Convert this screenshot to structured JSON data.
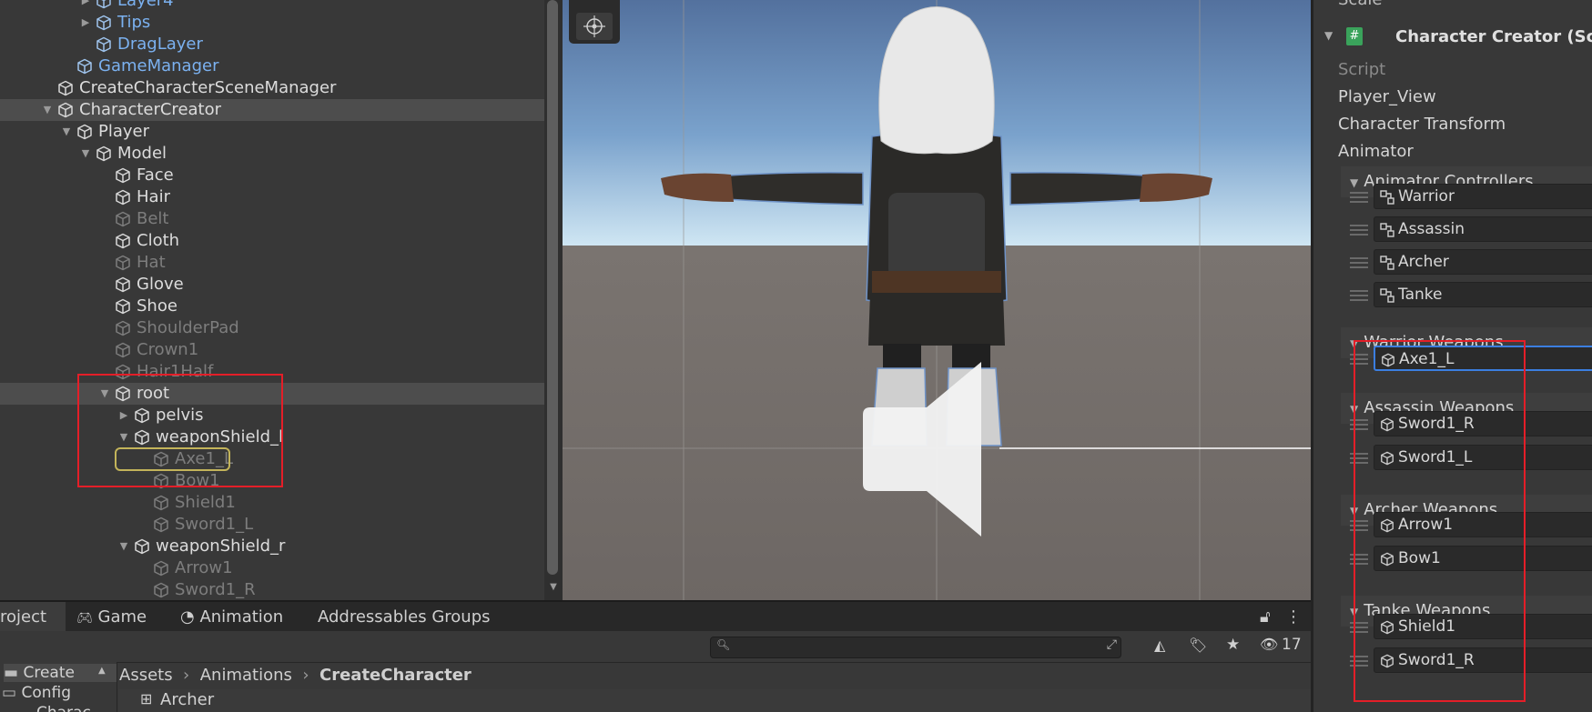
{
  "hierarchy": {
    "rows": [
      {
        "label": "Layer4",
        "depth": 4,
        "arrow": "right",
        "color": "blue"
      },
      {
        "label": "Tips",
        "depth": 4,
        "arrow": "right",
        "color": "blue"
      },
      {
        "label": "DragLayer",
        "depth": 4,
        "arrow": "",
        "color": "blue"
      },
      {
        "label": "GameManager",
        "depth": 3,
        "arrow": "",
        "color": "blue"
      },
      {
        "label": "CreateCharacterSceneManager",
        "depth": 2,
        "arrow": "",
        "color": "white"
      },
      {
        "label": "CharacterCreator",
        "depth": 2,
        "arrow": "down",
        "color": "white",
        "selected": true
      },
      {
        "label": "Player",
        "depth": 3,
        "arrow": "down",
        "color": "white"
      },
      {
        "label": "Model",
        "depth": 4,
        "arrow": "down",
        "color": "white"
      },
      {
        "label": "Face",
        "depth": 5,
        "arrow": "",
        "color": "white"
      },
      {
        "label": "Hair",
        "depth": 5,
        "arrow": "",
        "color": "white"
      },
      {
        "label": "Belt",
        "depth": 5,
        "arrow": "",
        "color": "dim"
      },
      {
        "label": "Cloth",
        "depth": 5,
        "arrow": "",
        "color": "white"
      },
      {
        "label": "Hat",
        "depth": 5,
        "arrow": "",
        "color": "dim"
      },
      {
        "label": "Glove",
        "depth": 5,
        "arrow": "",
        "color": "white"
      },
      {
        "label": "Shoe",
        "depth": 5,
        "arrow": "",
        "color": "white"
      },
      {
        "label": "ShoulderPad",
        "depth": 5,
        "arrow": "",
        "color": "dim"
      },
      {
        "label": "Crown1",
        "depth": 5,
        "arrow": "",
        "color": "dim"
      },
      {
        "label": "Hair1Half",
        "depth": 5,
        "arrow": "",
        "color": "dim"
      },
      {
        "label": "root",
        "depth": 5,
        "arrow": "down",
        "color": "white",
        "selected": true
      },
      {
        "label": "pelvis",
        "depth": 6,
        "arrow": "right",
        "color": "white"
      },
      {
        "label": "weaponShield_l",
        "depth": 6,
        "arrow": "down",
        "color": "white"
      },
      {
        "label": "Axe1_L",
        "depth": 7,
        "arrow": "",
        "color": "dim"
      },
      {
        "label": "Bow1",
        "depth": 7,
        "arrow": "",
        "color": "dim"
      },
      {
        "label": "Shield1",
        "depth": 7,
        "arrow": "",
        "color": "dim"
      },
      {
        "label": "Sword1_L",
        "depth": 7,
        "arrow": "",
        "color": "dim"
      },
      {
        "label": "weaponShield_r",
        "depth": 6,
        "arrow": "down",
        "color": "white"
      },
      {
        "label": "Arrow1",
        "depth": 7,
        "arrow": "",
        "color": "dim"
      },
      {
        "label": "Sword1_R",
        "depth": 7,
        "arrow": "",
        "color": "dim"
      }
    ]
  },
  "bottom": {
    "tabs": [
      {
        "label": "roject",
        "icon": ""
      },
      {
        "label": "Game",
        "icon": "gamepad-icon"
      },
      {
        "label": "Animation",
        "icon": "animation-clock-icon"
      },
      {
        "label": "Addressables Groups",
        "icon": ""
      }
    ],
    "hidden_count": "17",
    "folders": [
      {
        "label": "Create"
      },
      {
        "label": "Config"
      },
      {
        "label": "Charac"
      }
    ],
    "breadcrumb": [
      "Assets",
      "Animations",
      "CreateCharacter"
    ],
    "asset": "Archer"
  },
  "inspector": {
    "scale_label": "Scale",
    "component_title": "Character Creator (Scri",
    "fields": [
      "Script",
      "Player_View",
      "Character Transform",
      "Animator"
    ],
    "lists": [
      {
        "title": "Animator Controllers",
        "items": [
          "Warrior",
          "Assassin",
          "Archer",
          "Tanke"
        ],
        "icon": "animator-controller-icon"
      },
      {
        "title": "Warrior Weapons",
        "items": [
          "Axe1_L"
        ],
        "icon": "cube-icon"
      },
      {
        "title": "Assassin Weapons",
        "items": [
          "Sword1_R",
          "Sword1_L"
        ],
        "icon": "cube-icon"
      },
      {
        "title": "Archer Weapons",
        "items": [
          "Arrow1",
          "Bow1"
        ],
        "icon": "cube-icon"
      },
      {
        "title": "Tanke Weapons",
        "items": [
          "Shield1",
          "Sword1_R"
        ],
        "icon": "cube-icon"
      }
    ]
  },
  "colors": {
    "highlight_box": "#e41e28",
    "selection_outline": "#c3b45a",
    "focus_outline": "#3b7ee0"
  }
}
